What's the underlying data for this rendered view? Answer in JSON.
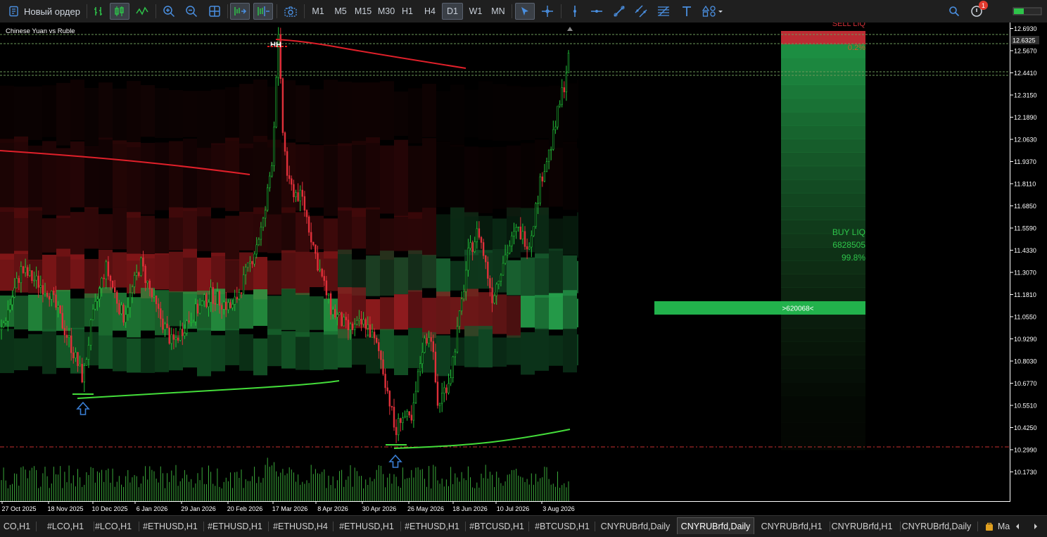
{
  "toolbar": {
    "new_order_label": "Новый ордер",
    "timeframes": [
      "M1",
      "M5",
      "M15",
      "M30",
      "H1",
      "H4",
      "D1",
      "W1",
      "MN"
    ],
    "active_timeframe": "D1",
    "notification_count": "1"
  },
  "chart": {
    "symbol_title": "Chinese Yuan vs Ruble",
    "current_price": "12.6325",
    "price_ticks": [
      "12.6930",
      "12.5670",
      "12.4410",
      "12.3150",
      "12.1890",
      "12.0630",
      "11.9370",
      "11.8110",
      "11.6850",
      "11.5590",
      "11.4330",
      "11.3070",
      "11.1810",
      "11.0550",
      "10.9290",
      "10.8030",
      "10.6770",
      "10.5510",
      "10.4250",
      "10.2990",
      "10.1730"
    ],
    "date_ticks": [
      "27 Oct 2025",
      "18 Nov 2025",
      "10 Dec 2025",
      "6 Jan 2026",
      "29 Jan 2026",
      "20 Feb 2026",
      "17 Mar 2026",
      "8 Apr 2026",
      "30 Apr 2026",
      "26 May 2026",
      "18 Jun 2026",
      "10 Jul 2026",
      "3 Aug 2026"
    ],
    "annotations": {
      "hh_label": "HH",
      "sell_liq_label": "SELL LIQ",
      "sell_liq_pct": "0.2%",
      "buy_liq_label": "BUY LIQ",
      "buy_liq_value": "6828505",
      "buy_liq_pct": "99.8%",
      "level_label": ">620068<"
    },
    "colors": {
      "bull_candle": "#22c33a",
      "bear_candle": "#e0303a",
      "resistance_line": "#e0202a",
      "support_line": "#44dd3a",
      "arrow": "#3a7fd5",
      "buy_zone": "#22a848",
      "sell_zone": "#d03038"
    }
  },
  "tabs": {
    "items": [
      "CO,H1",
      "#LCO,H1",
      "#LCO,H1",
      "#ETHUSD,H1",
      "#ETHUSD,H1",
      "#ETHUSD,H4",
      "#ETHUSD,H1",
      "#ETHUSD,H1",
      "#BTCUSD,H1",
      "#BTCUSD,H1",
      "CNYRUBrfd,Daily",
      "CNYRUBrfd,Daily",
      "CNYRUBrfd,H1",
      "CNYRUBrfd,H1",
      "CNYRUBrfd,Daily",
      "Ma"
    ],
    "active_index": 11
  }
}
